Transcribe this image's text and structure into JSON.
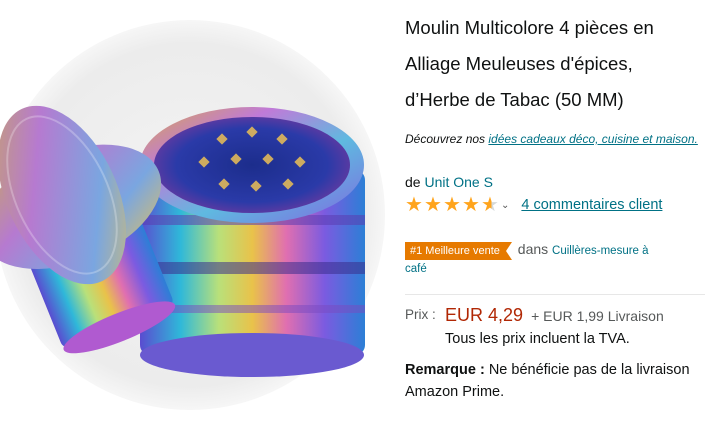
{
  "product": {
    "image_alt": "Moulin multicolore irisé 4 pièces",
    "title_lines": [
      "Moulin Multicolore 4 pièces en",
      "Alliage Meuleuses d'épices,",
      "d’Herbe de Tabac (50 MM)"
    ],
    "promo_prefix": "Découvrez nos",
    "promo_link": "idées cadeaux déco, cuisine et maison.",
    "brand_prefix": "de",
    "brand": "Unit One S",
    "rating": 4.5,
    "reviews": "4 commentaires client",
    "badge": "#1 Meilleure vente",
    "badge_in": "dans",
    "category_part1": "Cuillères-mesure à",
    "category_part2": "café",
    "price_label": "Prix :",
    "price": "EUR 4,29",
    "shipping": "+ EUR 1,99 Livraison",
    "tva": "Tous les prix incluent la TVA.",
    "note_label": "Remarque :",
    "note_text": "Ne bénéficie pas de la livraison Amazon Prime."
  },
  "colors": {
    "link": "#007185",
    "price": "#b12704",
    "badge": "#e67a00",
    "star": "#ffa41c"
  }
}
